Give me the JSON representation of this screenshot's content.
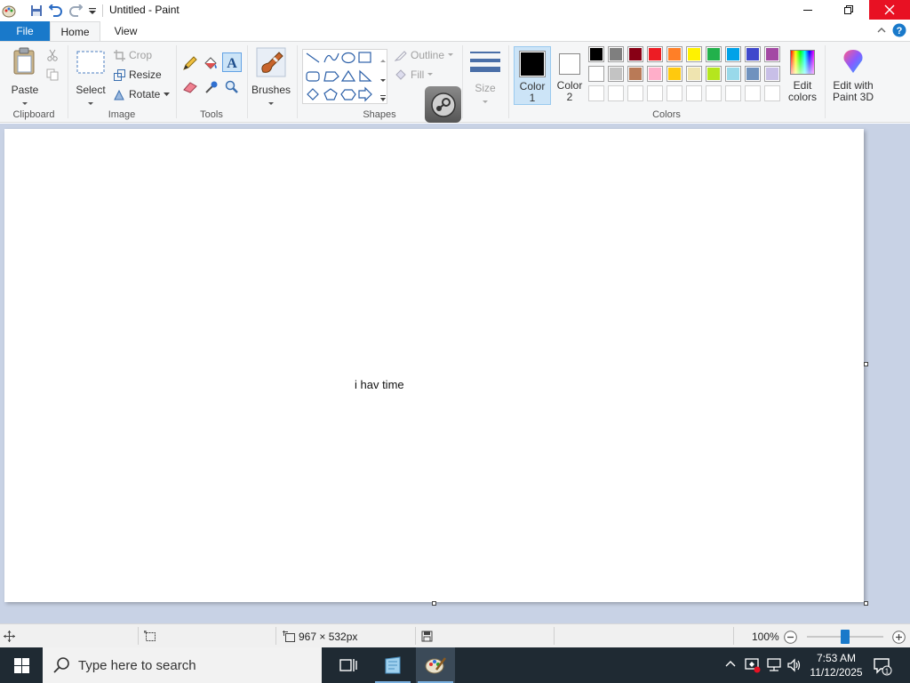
{
  "window": {
    "title": "Untitled - Paint"
  },
  "tabs": {
    "file": "File",
    "home": "Home",
    "view": "View"
  },
  "clipboard": {
    "paste": "Paste",
    "group": "Clipboard"
  },
  "image": {
    "select": "Select",
    "crop": "Crop",
    "resize": "Resize",
    "rotate": "Rotate",
    "group": "Image"
  },
  "tools": {
    "group": "Tools"
  },
  "brushes": {
    "label": "Brushes"
  },
  "shapes": {
    "outline": "Outline",
    "fill": "Fill",
    "group": "Shapes"
  },
  "size": {
    "label": "Size"
  },
  "colors": {
    "color1_label": "Color",
    "color1_num": "1",
    "color2_label": "Color",
    "color2_num": "2",
    "edit_line1": "Edit",
    "edit_line2": "colors",
    "group": "Colors",
    "color1": "#000000",
    "color2": "#ffffff",
    "palette_row1": [
      "#000000",
      "#7f7f7f",
      "#880015",
      "#ed1c24",
      "#ff7f27",
      "#fff200",
      "#22b14c",
      "#00a2e8",
      "#3f48cc",
      "#a349a4"
    ],
    "palette_row2": [
      "#ffffff",
      "#c3c3c3",
      "#b97a57",
      "#ffaec9",
      "#ffc90e",
      "#efe4b0",
      "#b5e61d",
      "#99d9ea",
      "#7092be",
      "#c8bfe7"
    ]
  },
  "paint3d": {
    "line1": "Edit with",
    "line2": "Paint 3D"
  },
  "canvas": {
    "text": "i hav time"
  },
  "status": {
    "dimensions": "967 × 532px",
    "zoom": "100%",
    "zoom_level": 100
  },
  "taskbar": {
    "search_placeholder": "Type here to search",
    "time": "7:53 AM",
    "date": "11/12/2025"
  }
}
